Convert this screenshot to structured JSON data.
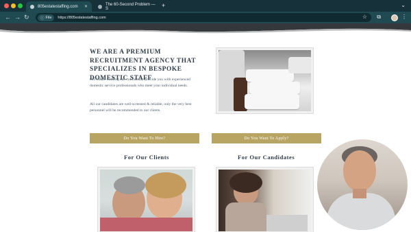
{
  "browser": {
    "colors": {
      "tabbar": "#17313a",
      "toolbar": "#1f4a52"
    },
    "window_controls": [
      "close",
      "minimize",
      "maximize"
    ],
    "tabs": [
      {
        "title": "805estatestaffing.com",
        "active": true
      },
      {
        "title": "The 60-Second Problem — S",
        "active": false
      }
    ],
    "new_tab": "+",
    "address": {
      "chip": "File",
      "url": "https://805estatestaffing.com"
    }
  },
  "page": {
    "colors": {
      "accent": "#b8a564",
      "heading": "#2f3d48",
      "body": "#4b5a64"
    },
    "heading": "We are a premium recruitment agency that specializes in bespoke domestic staff",
    "paragraph_1": "805 Estate Staffing can confidently provide you with experienced domestic service professionals who meet your individual needs.",
    "paragraph_2": "All our candidates are well-screened & reliable, only the very best personnel will be recommended to our clients.",
    "buttons": {
      "clients": "Do You Want To Hire?",
      "candidates": "Do You Want To Apply?"
    },
    "sections": {
      "clients": "For Our Clients",
      "candidates": "For Our Candidates"
    },
    "images": {
      "towels": "stack-of-white-towels-photo",
      "couple": "smiling-couple-photo",
      "woman": "woman-at-laptop-photo"
    }
  },
  "overlay": {
    "webcam": "presenter-webcam-circle"
  }
}
